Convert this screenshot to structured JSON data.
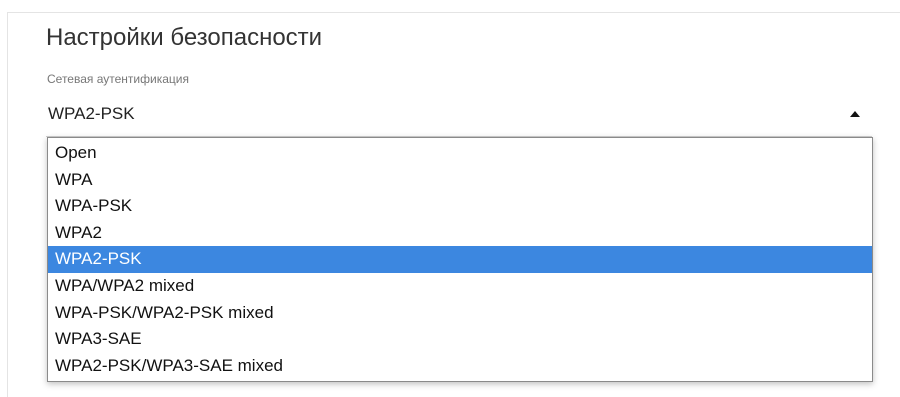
{
  "section": {
    "title": "Настройки безопасности"
  },
  "auth_field": {
    "label": "Сетевая аутентификация",
    "value": "WPA2-PSK",
    "options": [
      "Open",
      "WPA",
      "WPA-PSK",
      "WPA2",
      "WPA2-PSK",
      "WPA/WPA2 mixed",
      "WPA-PSK/WPA2-PSK mixed",
      "WPA3-SAE",
      "WPA2-PSK/WPA3-SAE mixed"
    ],
    "selected_index": 4
  },
  "colors": {
    "highlight": "#3c87e0",
    "text": "#222222",
    "label": "#777777"
  },
  "icons": {
    "caret": "caret-up-icon"
  }
}
